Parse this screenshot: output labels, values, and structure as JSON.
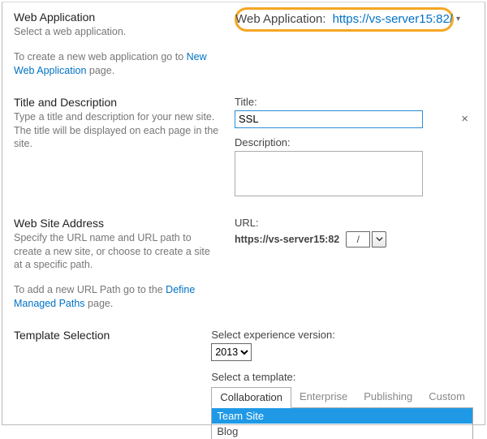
{
  "webapp": {
    "title": "Web Application",
    "desc": "Select a web application.",
    "help_prefix": "To create a new web application go to ",
    "help_link": "New Web Application",
    "help_suffix": " page.",
    "picker_label": "Web Application:",
    "picker_value": "https://vs-server15:82/"
  },
  "titledesc": {
    "title": "Title and Description",
    "desc": "Type a title and description for your new site. The title will be displayed on each page in the site.",
    "title_label": "Title:",
    "title_value": "SSL",
    "desc_label": "Description:",
    "desc_value": ""
  },
  "address": {
    "title": "Web Site Address",
    "desc": "Specify the URL name and URL path to create a new site, or choose to create a site at a specific path.",
    "help_prefix": "To add a new URL Path go to the ",
    "help_link": "Define Managed Paths",
    "help_suffix": " page.",
    "url_label": "URL:",
    "url_base": "https://vs-server15:82",
    "url_path": "/"
  },
  "template": {
    "title": "Template Selection",
    "exp_label": "Select experience version:",
    "exp_value": "2013",
    "sel_label": "Select a template:",
    "tabs": [
      "Collaboration",
      "Enterprise",
      "Publishing",
      "Custom"
    ],
    "active_tab": 0,
    "items": [
      "Team Site",
      "Blog"
    ],
    "selected_item": 0
  }
}
